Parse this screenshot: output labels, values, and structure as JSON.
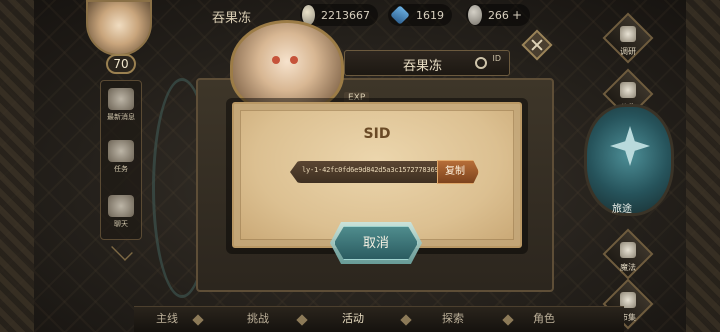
{
  "topbar": {
    "player_name": "吞果冻",
    "gold": "2213667",
    "gems": "1619",
    "stone": "266",
    "plus": "+"
  },
  "profile": {
    "level": "70",
    "name_plate": "吞果冻",
    "id_label": "ID",
    "exp_chip": "EXP"
  },
  "left_menu": [
    {
      "label": "最新消息",
      "icon": "news-icon"
    },
    {
      "label": "任务",
      "icon": "task-icon"
    },
    {
      "label": "聊天",
      "icon": "chat-icon"
    }
  ],
  "right_menu": [
    {
      "label": "调研",
      "icon": "research-icon"
    },
    {
      "label": "公告",
      "icon": "notice-icon"
    },
    {
      "label": "旅途",
      "icon": "journey-icon"
    },
    {
      "label": "魔法",
      "icon": "magic-icon"
    },
    {
      "label": "市集",
      "icon": "market-icon"
    }
  ],
  "modal": {
    "title": "SID",
    "sid_value": "ly-1-42fc0fd6e9d842d5a3c1572778369908",
    "copy_label": "复制",
    "cancel_label": "取消"
  },
  "bottom_tabs": [
    "主线",
    "挑战",
    "活动",
    "探索",
    "角色"
  ],
  "colors": {
    "modal_bg": "#dcc091",
    "title_text": "#6a4a26",
    "copy_button": "#9c5a2a",
    "cancel_button": "#3d7476"
  }
}
